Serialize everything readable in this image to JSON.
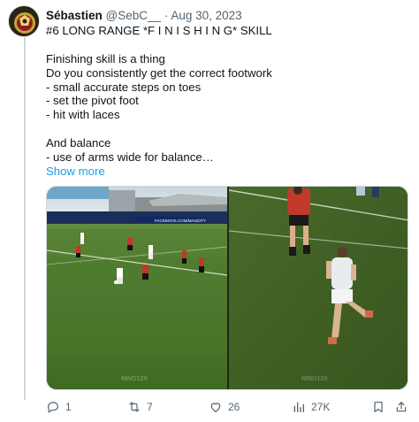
{
  "tweet": {
    "author_name": "Sébastien",
    "handle": "@SebC__",
    "separator": "·",
    "date": "Aug 30, 2023",
    "lines": [
      "#6 LONG RANGE *F I N I S H I N G* SKILL",
      "",
      "Finishing skill is a thing",
      "Do you consistently get the correct footwork",
      "- small accurate steps on toes",
      "- set the pivot foot",
      "- hit with laces",
      "",
      "And balance",
      "- use of arms wide for balance…"
    ],
    "show_more": "Show more"
  },
  "media": {
    "left_watermark": "NINO12X",
    "right_watermark": "NINO12X",
    "banner_text": "FACEBOOK.COM/MANCITY"
  },
  "actions": {
    "replies": "1",
    "reposts": "7",
    "likes": "26",
    "views": "27K"
  },
  "colors": {
    "accent": "#1d9bf0",
    "muted": "#536471",
    "text": "#0f1419"
  }
}
